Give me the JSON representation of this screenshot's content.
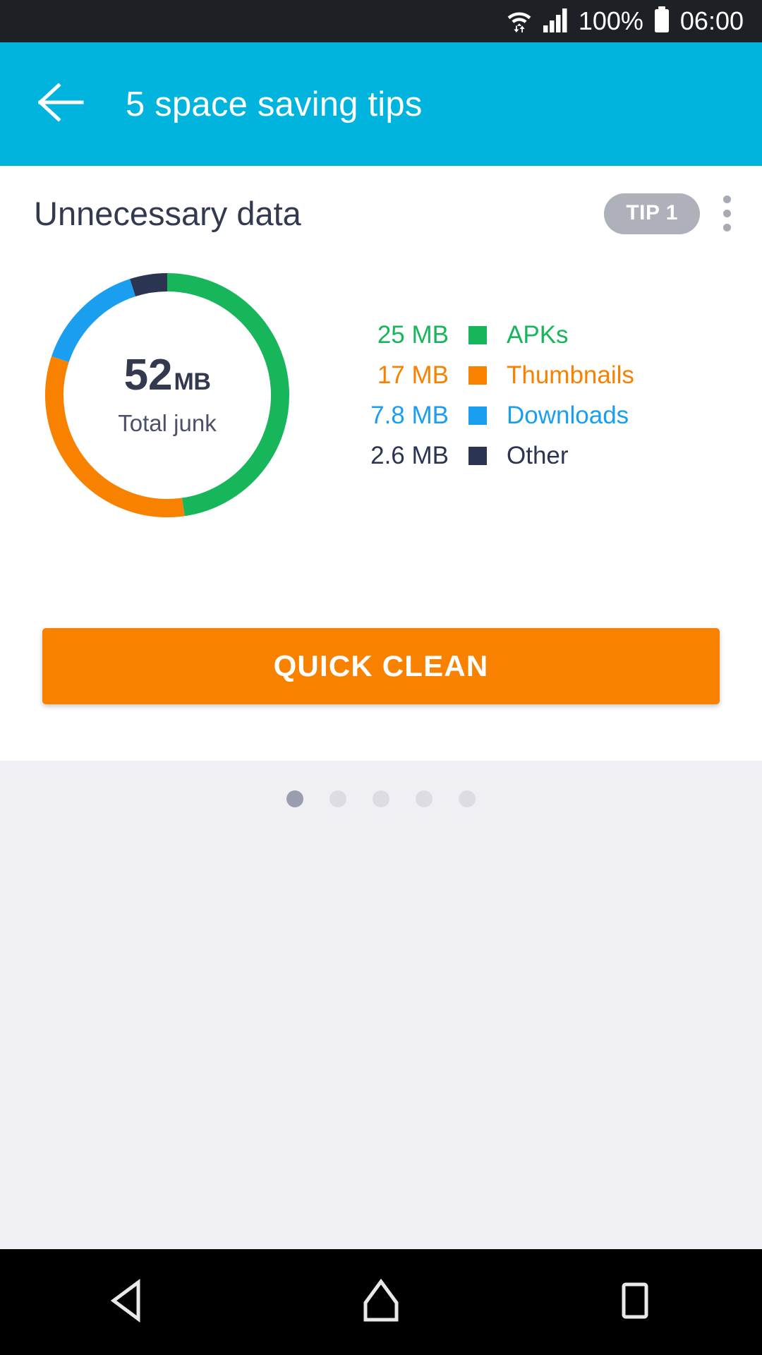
{
  "status_bar": {
    "wifi_icon": "wifi-with-transfer-arrows-icon",
    "signal_icon": "cellular-signal-icon",
    "battery_percent": "100%",
    "battery_icon": "battery-full-icon",
    "time": "06:00"
  },
  "app_bar": {
    "back_icon": "arrow-left-icon",
    "title": "5 space saving tips"
  },
  "card": {
    "title": "Unnecessary data",
    "tip_badge": "TIP 1",
    "overflow_icon": "kebab-menu-icon",
    "donut": {
      "total_value": "52",
      "total_unit": "MB",
      "caption": "Total junk"
    },
    "cta_label": "QUICK CLEAN"
  },
  "pager": {
    "total": 5,
    "active_index": 0
  },
  "nav_bar": {
    "back_icon": "nav-back-triangle-icon",
    "home_icon": "nav-home-icon",
    "recents_icon": "nav-recents-square-icon"
  },
  "colors": {
    "accent_blue": "#00b4dd",
    "cta_orange": "#f98100",
    "apks_green": "#18b65a",
    "thumbnails_orange": "#f98100",
    "downloads_blue": "#1a9ef0",
    "other_navy": "#2b3450",
    "badge_gray": "#aeb0ba",
    "backdrop_gray": "#f0f0f4",
    "text_navy": "#333a4f"
  },
  "chart_data": {
    "type": "pie",
    "title": "Unnecessary data",
    "center_label": "52 MB",
    "center_sublabel": "Total junk",
    "unit": "MB",
    "total": 52.4,
    "start_angle_deg": 0,
    "direction": "clockwise",
    "inner_radius_ratio": 0.84,
    "legend_position": "right",
    "categories": [
      "APKs",
      "Thumbnails",
      "Downloads",
      "Other"
    ],
    "values": [
      25,
      17,
      7.8,
      2.6
    ],
    "value_labels": [
      "25 MB",
      "17 MB",
      "7.8 MB",
      "2.6 MB"
    ],
    "colors": [
      "#18b65a",
      "#f98100",
      "#1a9ef0",
      "#2b3450"
    ],
    "segments": [
      {
        "label": "APKs",
        "value": 25,
        "value_label": "25 MB",
        "color": "#18b65a",
        "start_deg": 0,
        "sweep_deg": 171.8
      },
      {
        "label": "Thumbnails",
        "value": 17,
        "value_label": "17 MB",
        "color": "#f98100",
        "start_deg": 171.8,
        "sweep_deg": 116.8
      },
      {
        "label": "Downloads",
        "value": 7.8,
        "value_label": "7.8 MB",
        "color": "#1a9ef0",
        "start_deg": 288.6,
        "sweep_deg": 53.6
      },
      {
        "label": "Other",
        "value": 2.6,
        "value_label": "2.6 MB",
        "color": "#2b3450",
        "start_deg": 342.2,
        "sweep_deg": 17.8
      }
    ]
  }
}
